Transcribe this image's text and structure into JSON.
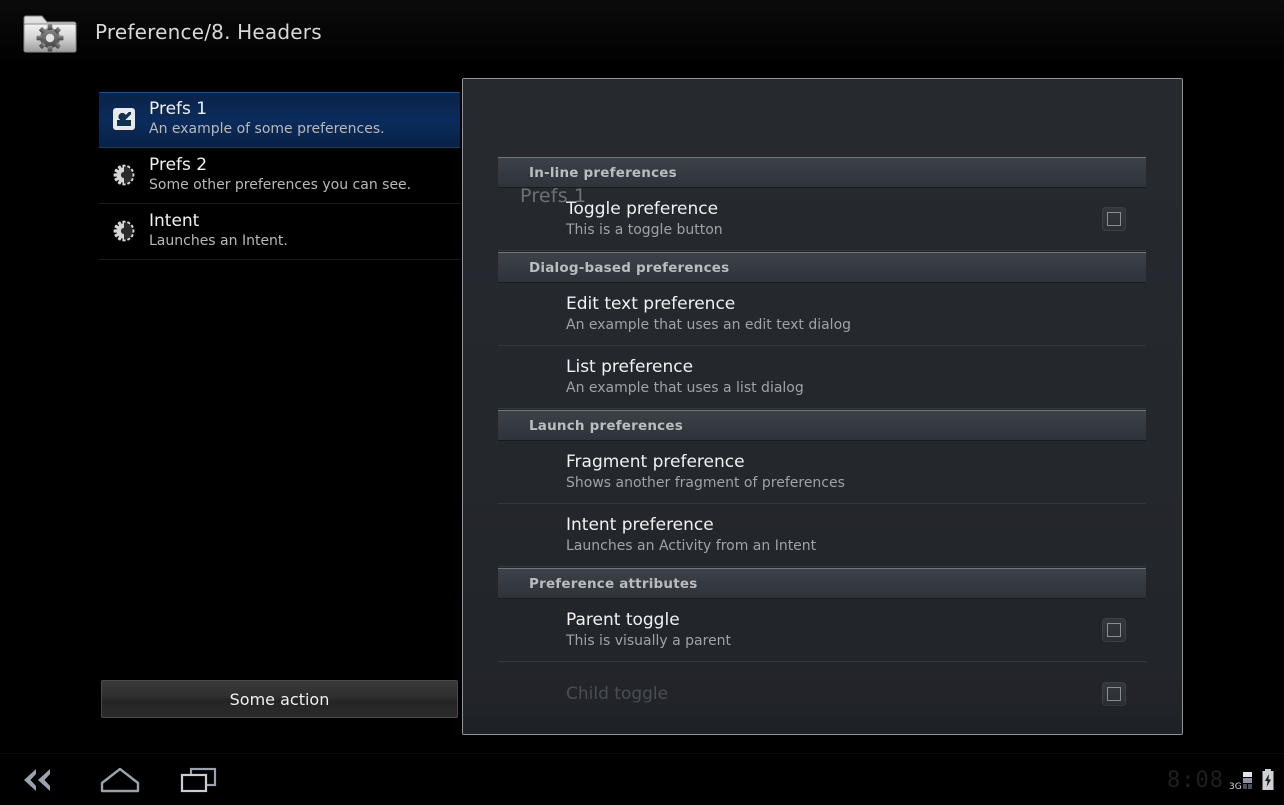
{
  "actionbar": {
    "app_icon": "folder-gear-icon",
    "title": "Preference/8. Headers"
  },
  "headers": {
    "items": [
      {
        "icon": "android-preferences-icon",
        "title": "Prefs 1",
        "summary": "An example of some preferences.",
        "selected": true
      },
      {
        "icon": "gear-icon",
        "title": "Prefs 2",
        "summary": "Some other preferences you can see.",
        "selected": false
      },
      {
        "icon": "gear-icon",
        "title": "Intent",
        "summary": "Launches an Intent.",
        "selected": false
      }
    ],
    "action_button_label": "Some action"
  },
  "dialog": {
    "title": "Prefs 1",
    "sections": [
      {
        "header": "In-line preferences",
        "rows": [
          {
            "title": "Toggle preference",
            "summary": "This is a toggle button",
            "widget": "checkbox",
            "checked": false,
            "dim": false
          }
        ]
      },
      {
        "header": "Dialog-based preferences",
        "rows": [
          {
            "title": "Edit text preference",
            "summary": "An example that uses an edit text dialog",
            "widget": "none",
            "checked": false,
            "dim": false
          },
          {
            "title": "List preference",
            "summary": "An example that uses a list dialog",
            "widget": "none",
            "checked": false,
            "dim": false
          }
        ]
      },
      {
        "header": "Launch preferences",
        "rows": [
          {
            "title": "Fragment preference",
            "summary": "Shows another fragment of preferences",
            "widget": "none",
            "checked": false,
            "dim": false
          },
          {
            "title": "Intent preference",
            "summary": "Launches an Activity from an Intent",
            "widget": "none",
            "checked": false,
            "dim": false
          }
        ]
      },
      {
        "header": "Preference attributes",
        "rows": [
          {
            "title": "Parent toggle",
            "summary": "This is visually a parent",
            "widget": "checkbox",
            "checked": false,
            "dim": false
          },
          {
            "title": "Child toggle",
            "summary": "",
            "widget": "checkbox",
            "checked": false,
            "dim": true
          }
        ]
      }
    ]
  },
  "systembar": {
    "back_icon": "back-icon",
    "home_icon": "home-icon",
    "recents_icon": "recent-apps-icon",
    "clock": "8:08",
    "network_label": "3G",
    "signal_icon": "signal-bars-icon",
    "battery_icon": "battery-charging-icon"
  },
  "colors": {
    "selection_blue": "#0a2c5c",
    "dialog_bg": "#24272c",
    "section_header_bg": "#353a40",
    "screen_bg": "#000000"
  }
}
